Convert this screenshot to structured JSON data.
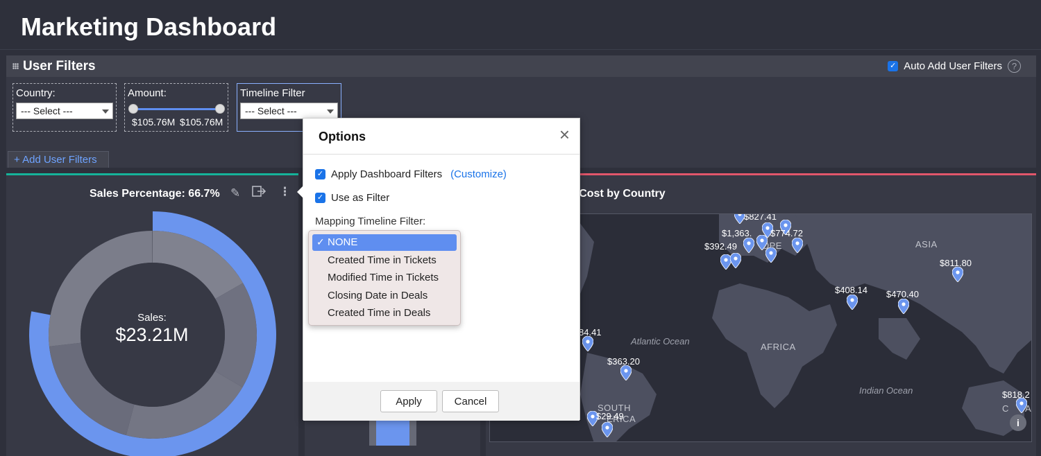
{
  "page": {
    "title": "Marketing Dashboard"
  },
  "user_filters": {
    "title": "User Filters",
    "auto_add_label": "Auto Add User Filters",
    "help_glyph": "?",
    "add_label": "+ Add User Filters",
    "country": {
      "label": "Country:",
      "value": "--- Select ---"
    },
    "amount": {
      "label": "Amount:",
      "min_value": "$105.76M",
      "max_value": "$105.76M"
    },
    "timeline": {
      "label": "Timeline Filter",
      "value": "--- Select ---"
    }
  },
  "sales_card": {
    "title": "Sales Percentage: 66.7%",
    "center_label": "Sales:",
    "center_value": "$23.21M",
    "percentage": 66.7,
    "accent": "#6b95ee"
  },
  "map_card": {
    "title_visible": "n Cost by Country",
    "regions": [
      "ASIA",
      "OPE",
      "AFRICA",
      "SOUTH",
      "ERICA"
    ],
    "oceans": [
      "Atlantic Ocean",
      "Indian Ocean"
    ],
    "labels": [
      "$827.41",
      "$1,363.",
      "$774.72",
      "$392.49",
      "$811.80",
      "$408.14",
      "$470.40",
      "84.41",
      "$363.20",
      "$29.49",
      "$818.2",
      "C",
      "A"
    ],
    "pin_color": "#6b95ee",
    "info_glyph": "i"
  },
  "options_dialog": {
    "title": "Options",
    "close_glyph": "×",
    "apply_dashboard_filters": "Apply Dashboard Filters",
    "customize_link": "(Customize)",
    "use_as_filter": "Use as Filter",
    "mapping_label": "Mapping Timeline Filter:",
    "apply_button": "Apply",
    "cancel_button": "Cancel",
    "dropdown": {
      "check_glyph": "✓",
      "selected_index": 0,
      "options": [
        "NONE",
        "Created Time in Tickets",
        "Modified Time in Tickets",
        "Closing Date in Deals",
        "Created Time in Deals"
      ]
    }
  },
  "colors": {
    "background": "#2e303b",
    "panel": "#373945",
    "accent_blue": "#1a73e8",
    "teal_top": "#15b39a",
    "red_top": "#e2566b"
  }
}
